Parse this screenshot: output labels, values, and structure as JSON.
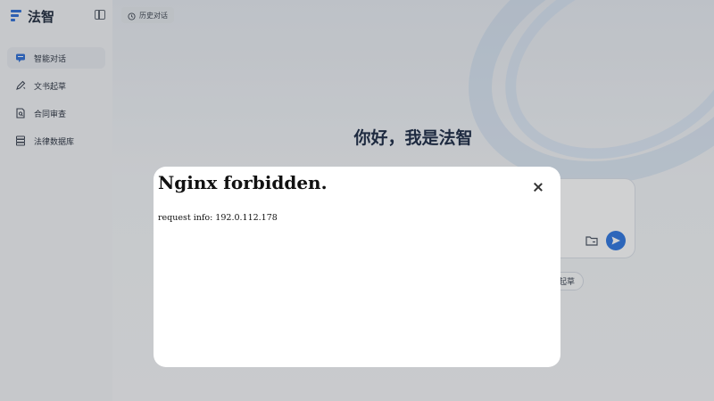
{
  "app": {
    "name": "法智",
    "brand_color": "#2f6fd6"
  },
  "sidebar": {
    "items": [
      {
        "label": "智能对话",
        "icon": "chat-icon",
        "active": true
      },
      {
        "label": "文书起草",
        "icon": "pen-icon",
        "active": false
      },
      {
        "label": "合同审查",
        "icon": "document-search-icon",
        "active": false
      },
      {
        "label": "法律数据库",
        "icon": "database-icon",
        "active": false
      }
    ]
  },
  "main": {
    "history_label": "历史对话",
    "greeting": "你好，我是法智",
    "chip_label": "书起草",
    "send_color": "#2f77e0"
  },
  "modal": {
    "title": "Nginx forbidden.",
    "info": "request info: 192.0.112.178"
  }
}
